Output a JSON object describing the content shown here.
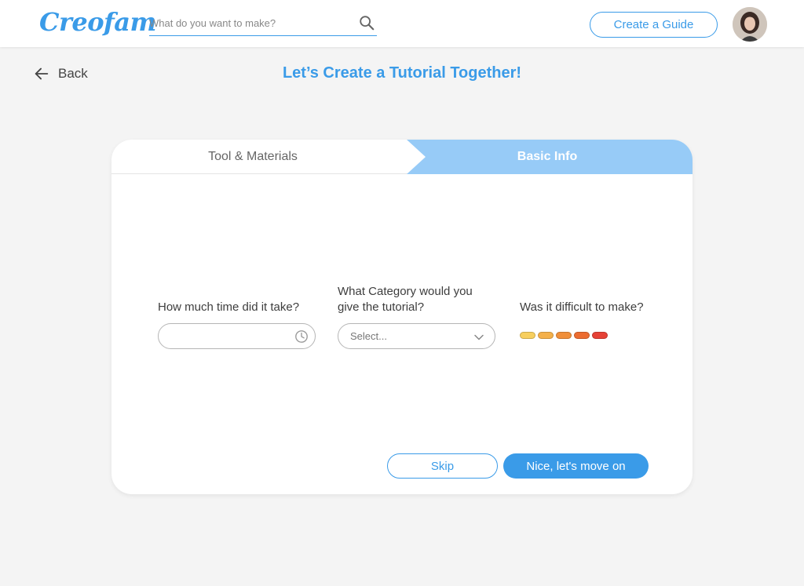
{
  "header": {
    "logo_text": "Creofam",
    "search_placeholder": "What do you want to make?",
    "create_guide_label": "Create a Guide"
  },
  "nav": {
    "back_label": "Back"
  },
  "page": {
    "title": "Let’s Create a Tutorial Together!"
  },
  "tabs": [
    {
      "label": "Tool & Materials",
      "active": false
    },
    {
      "label": "Basic Info",
      "active": true
    }
  ],
  "form": {
    "time_label": "How much time did it take?",
    "time_value": "",
    "category_label": "What Category would you give the tutorial?",
    "category_placeholder": "Select...",
    "difficulty_label": "Was it difficult to make?",
    "difficulty_levels": [
      "#f7cf5e",
      "#f4b04a",
      "#f08f3a",
      "#ec6c30",
      "#e64236"
    ]
  },
  "actions": {
    "skip_label": "Skip",
    "next_label": "Nice, let's move on"
  },
  "colors": {
    "accent": "#3a9be8",
    "active_tab": "#97cbf7",
    "background": "#f4f4f4"
  }
}
